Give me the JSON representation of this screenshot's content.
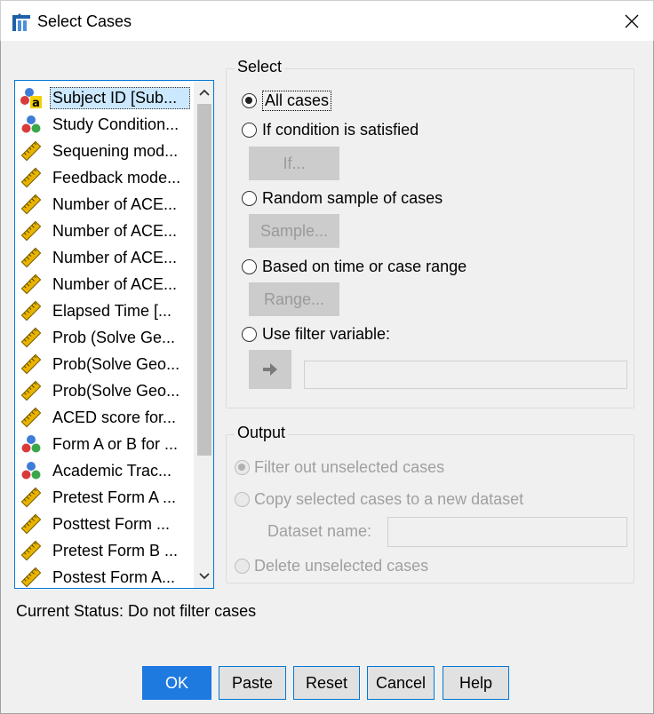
{
  "window": {
    "title": "Select Cases",
    "app_icon": "spss-select-cases-icon",
    "close_glyph": "✕"
  },
  "variables": [
    {
      "label": "Subject ID [Sub...",
      "icon": "nominal-string-icon",
      "selected": true
    },
    {
      "label": "Study Condition...",
      "icon": "nominal-icon"
    },
    {
      "label": "Sequening mod...",
      "icon": "scale-icon"
    },
    {
      "label": "Feedback mode...",
      "icon": "scale-icon"
    },
    {
      "label": "Number of ACE...",
      "icon": "scale-icon"
    },
    {
      "label": "Number of ACE...",
      "icon": "scale-icon"
    },
    {
      "label": "Number of ACE...",
      "icon": "scale-icon"
    },
    {
      "label": "Number of ACE...",
      "icon": "scale-icon"
    },
    {
      "label": "Elapsed Time [...",
      "icon": "scale-icon"
    },
    {
      "label": "Prob (Solve Ge...",
      "icon": "scale-icon"
    },
    {
      "label": "Prob(Solve Geo...",
      "icon": "scale-icon"
    },
    {
      "label": "Prob(Solve Geo...",
      "icon": "scale-icon"
    },
    {
      "label": "ACED score for...",
      "icon": "scale-icon"
    },
    {
      "label": "Form A or B for ...",
      "icon": "nominal-icon"
    },
    {
      "label": "Academic Trac...",
      "icon": "nominal-icon"
    },
    {
      "label": "Pretest Form A ...",
      "icon": "scale-icon"
    },
    {
      "label": "Posttest Form ...",
      "icon": "scale-icon"
    },
    {
      "label": "Pretest Form B ...",
      "icon": "scale-icon"
    },
    {
      "label": "Postest Form A...",
      "icon": "scale-icon"
    }
  ],
  "select": {
    "title": "Select",
    "options": [
      {
        "label": "All cases",
        "checked": true
      },
      {
        "label": "If condition is satisfied",
        "checked": false
      },
      {
        "label": "Random sample of cases",
        "checked": false
      },
      {
        "label": "Based on time or case range",
        "checked": false
      },
      {
        "label": "Use filter variable:",
        "checked": false
      }
    ],
    "if_button": "If...",
    "sample_button": "Sample...",
    "range_button": "Range...",
    "filter_variable_value": ""
  },
  "output": {
    "title": "Output",
    "options": [
      {
        "label": "Filter out unselected cases",
        "checked": true,
        "enabled": false
      },
      {
        "label": "Copy selected cases to a new dataset",
        "checked": false,
        "enabled": false
      },
      {
        "label": "Delete unselected cases",
        "checked": false,
        "enabled": false
      }
    ],
    "dataset_name_label": "Dataset name:",
    "dataset_name_value": ""
  },
  "status": "Current Status: Do not filter cases",
  "buttons": {
    "ok": "OK",
    "paste": "Paste",
    "reset": "Reset",
    "cancel": "Cancel",
    "help": "Help"
  },
  "colors": {
    "accent": "#0078d7",
    "ok_button": "#1f7ae0",
    "disabled_button": "#cccccc",
    "selection": "#cce8ff"
  }
}
